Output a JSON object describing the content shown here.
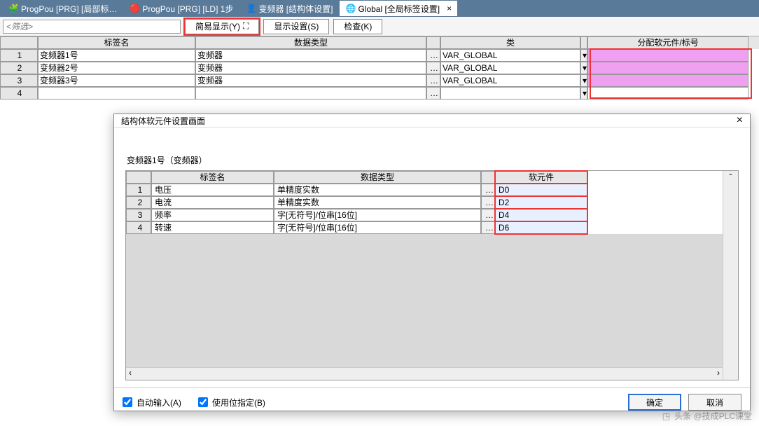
{
  "tabs": [
    {
      "label": "ProgPou [PRG] [局部标…"
    },
    {
      "label": "ProgPou [PRG] [LD] 1步"
    },
    {
      "label": "变频器 [结构体设置]"
    },
    {
      "label": "Global [全局标签设置]",
      "active": true
    }
  ],
  "toolbar": {
    "filter_placeholder": "<筛选>",
    "easy_display": "简易显示(Y)",
    "display_setting": "显示设置(S)",
    "check": "检查(K)"
  },
  "main_table": {
    "headers": {
      "label_name": "标签名",
      "data_type": "数据类型",
      "class": "类",
      "alloc_dev": "分配软元件/标号"
    },
    "rows": [
      {
        "n": "1",
        "name": "变频器1号",
        "type": "变频器",
        "cls": "VAR_GLOBAL",
        "dev": ""
      },
      {
        "n": "2",
        "name": "变频器2号",
        "type": "变频器",
        "cls": "VAR_GLOBAL",
        "dev": ""
      },
      {
        "n": "3",
        "name": "变频器3号",
        "type": "变频器",
        "cls": "VAR_GLOBAL",
        "dev": ""
      },
      {
        "n": "4",
        "name": "",
        "type": "",
        "cls": "",
        "dev": ""
      }
    ]
  },
  "dialog": {
    "title": "结构体软元件设置画面",
    "subtitle": "变频器1号（变频器）",
    "headers": {
      "label_name": "标签名",
      "data_type": "数据类型",
      "device": "软元件"
    },
    "rows": [
      {
        "n": "1",
        "name": "电压",
        "type": "单精度实数",
        "dev": "D0"
      },
      {
        "n": "2",
        "name": "电流",
        "type": "单精度实数",
        "dev": "D2"
      },
      {
        "n": "3",
        "name": "频率",
        "type": "字[无符号]/位串[16位]",
        "dev": "D4"
      },
      {
        "n": "4",
        "name": "转速",
        "type": "字[无符号]/位串[16位]",
        "dev": "D6"
      }
    ],
    "auto_input": "自动输入(A)",
    "use_bit_spec": "使用位指定(B)",
    "ok": "确定",
    "cancel": "取消"
  },
  "watermark": "头条 @技成PLC课堂"
}
